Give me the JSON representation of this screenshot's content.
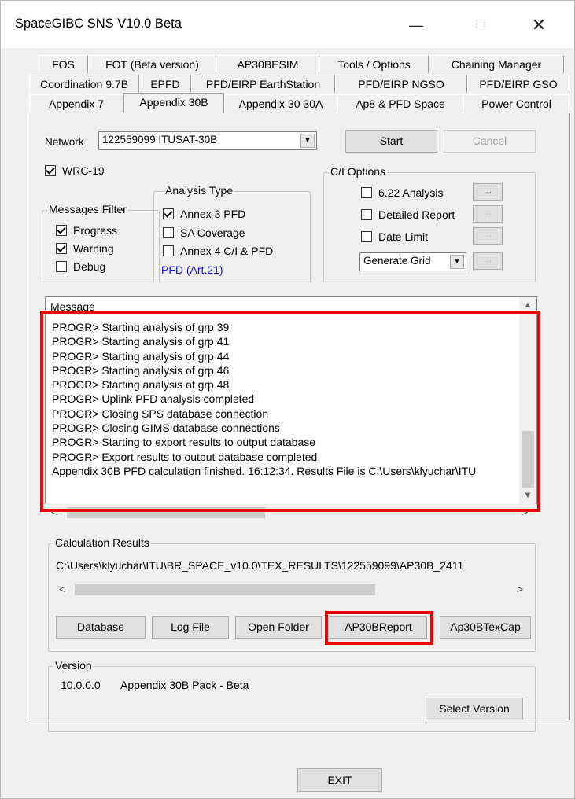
{
  "window": {
    "title": "SpaceGIBC SNS V10.0 Beta"
  },
  "controls": {
    "minimize": "—",
    "maximize": "☐",
    "close": "✕"
  },
  "tabs": {
    "row1": [
      "FOS",
      "FOT (Beta version)",
      "AP30BESIM",
      "Tools / Options",
      "Chaining Manager"
    ],
    "row2": [
      "Coordination 9.7B",
      "EPFD",
      "PFD/EIRP EarthStation",
      "PFD/EIRP NGSO",
      "PFD/EIRP GSO"
    ],
    "row3": [
      "Appendix 7",
      "Appendix 30B",
      "Appendix 30 30A",
      "Ap8 & PFD Space",
      "Power Control"
    ],
    "active": "Appendix 30B"
  },
  "network": {
    "label": "Network",
    "value": "122559099  ITUSAT-30B"
  },
  "buttons": {
    "start": "Start",
    "cancel": "Cancel",
    "exit": "EXIT",
    "dots": "..."
  },
  "wrc": {
    "label": "WRC-19",
    "checked": true
  },
  "messages_filter": {
    "title": "Messages Filter",
    "items": [
      {
        "label": "Progress",
        "checked": true
      },
      {
        "label": "Warning",
        "checked": true
      },
      {
        "label": "Debug",
        "checked": false
      }
    ]
  },
  "analysis_type": {
    "title": "Analysis Type",
    "items": [
      {
        "label": "Annex 3 PFD",
        "checked": true
      },
      {
        "label": "SA Coverage",
        "checked": false
      },
      {
        "label": "Annex 4 C/I & PFD",
        "checked": false
      }
    ],
    "link": "PFD (Art.21)"
  },
  "ci_options": {
    "title": "C/I Options",
    "items": [
      {
        "label": "6.22 Analysis",
        "checked": false
      },
      {
        "label": "Detailed Report",
        "checked": false
      },
      {
        "label": "Date Limit",
        "checked": false
      }
    ],
    "grid_select": "Generate Grid"
  },
  "message_list": {
    "header": "Message",
    "lines": [
      "PROGR> Starting analysis of grp 39",
      "PROGR> Starting analysis of grp 41",
      "PROGR> Starting analysis of grp 44",
      "PROGR> Starting analysis of grp 46",
      "PROGR> Starting analysis of grp 48",
      "PROGR> Uplink PFD analysis completed",
      "PROGR> Closing SPS database connection",
      "PROGR> Closing GIMS database connections",
      "PROGR> Starting to export results to output database",
      "PROGR> Export results to output database completed",
      "Appendix 30B PFD calculation finished. 16:12:34. Results File is C:\\Users\\klyuchar\\ITU"
    ]
  },
  "calc_results": {
    "title": "Calculation Results",
    "path": "C:\\Users\\klyuchar\\ITU\\BR_SPACE_v10.0\\TEX_RESULTS\\122559099\\AP30B_2411",
    "buttons": [
      "Database",
      "Log File",
      "Open Folder",
      "AP30BReport",
      "Ap30BTexCap"
    ]
  },
  "version": {
    "title": "Version",
    "number": "10.0.0.0",
    "pack": "Appendix 30B Pack - Beta",
    "select": "Select Version"
  },
  "highlight_color": "#ee0000"
}
